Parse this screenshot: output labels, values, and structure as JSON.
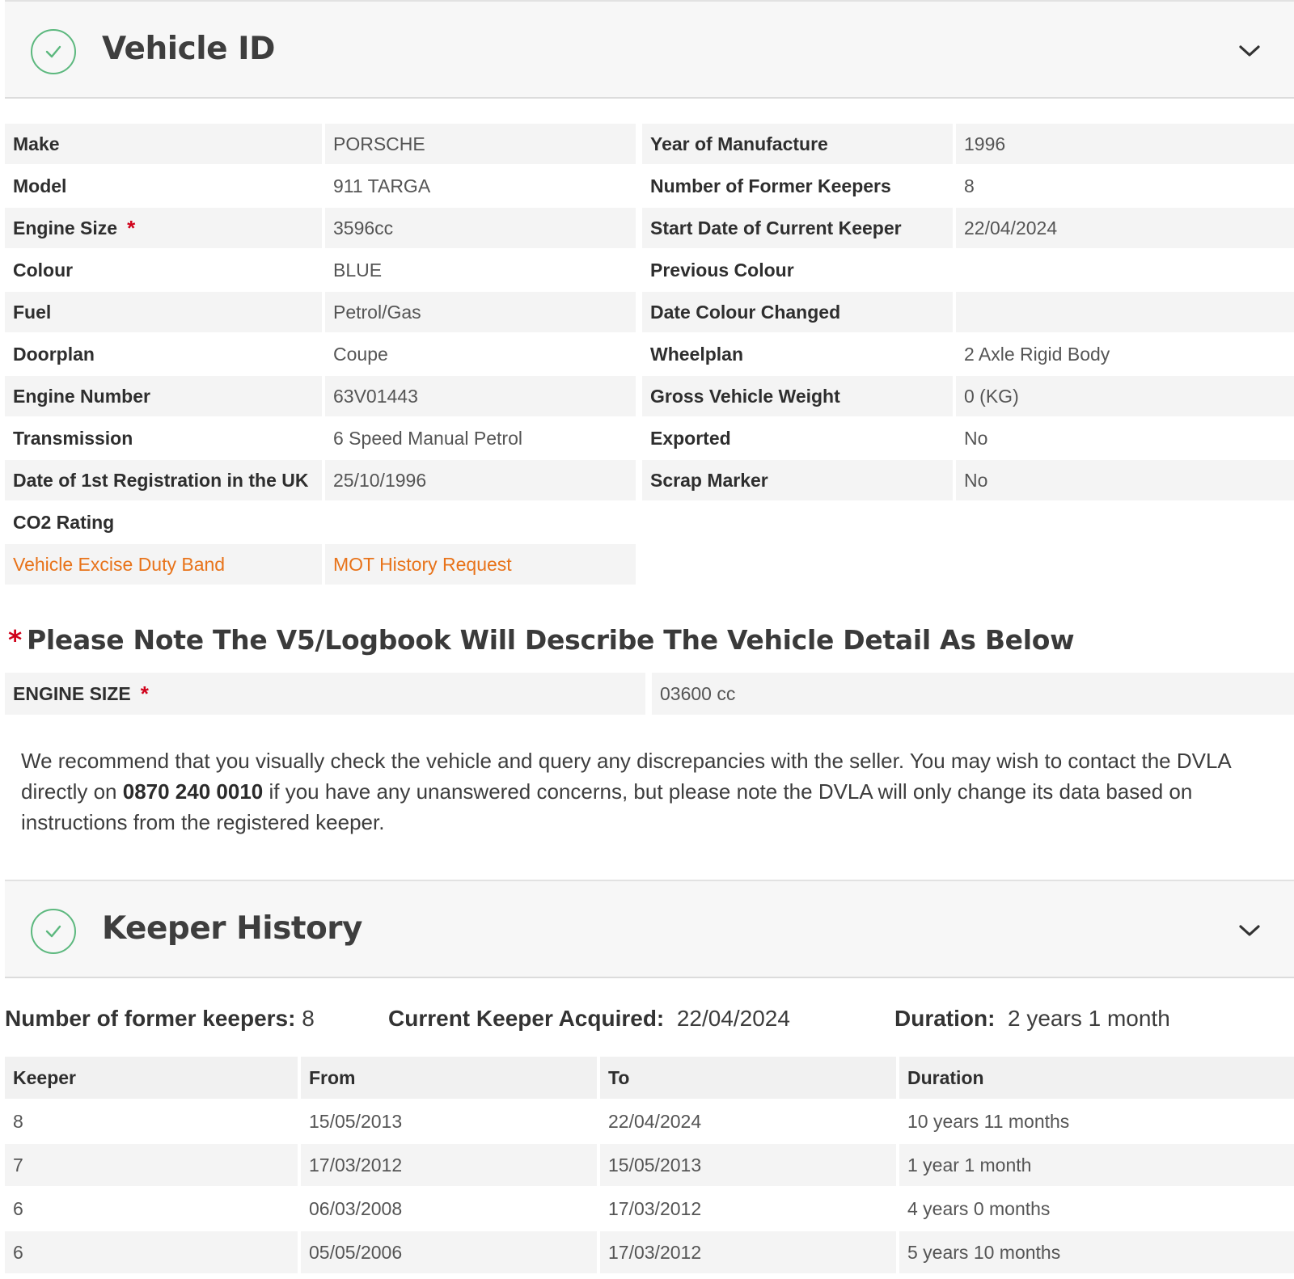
{
  "vehicle_id": {
    "title": "Vehicle ID",
    "rows": [
      {
        "l1": "Make",
        "v1": "PORSCHE",
        "l2": "Year of Manufacture",
        "v2": "1996"
      },
      {
        "l1": "Model",
        "v1": "911 TARGA",
        "l2": "Number of Former Keepers",
        "v2": "8"
      },
      {
        "l1": "Engine Size",
        "v1": "3596cc",
        "l2": "Start Date of Current Keeper",
        "v2": "22/04/2024"
      },
      {
        "l1": "Colour",
        "v1": "BLUE",
        "l2": "Previous Colour",
        "v2": ""
      },
      {
        "l1": "Fuel",
        "v1": "Petrol/Gas",
        "l2": "Date Colour Changed",
        "v2": ""
      },
      {
        "l1": "Doorplan",
        "v1": "Coupe",
        "l2": "Wheelplan",
        "v2": "2 Axle Rigid Body"
      },
      {
        "l1": "Engine Number",
        "v1": "63V01443",
        "l2": "Gross Vehicle Weight",
        "v2": "0 (KG)"
      },
      {
        "l1": "Transmission",
        "v1": "6 Speed Manual Petrol",
        "l2": "Exported",
        "v2": "No"
      },
      {
        "l1": "Date of 1st Registration in the UK",
        "v1": "25/10/1996",
        "l2": "Scrap Marker",
        "v2": "No"
      },
      {
        "l1": "CO2 Rating",
        "v1": ""
      },
      {
        "l1": "Vehicle Excise Duty Band",
        "v1": "MOT History Request"
      }
    ],
    "required_mark": "*"
  },
  "v5_note": {
    "star": "*",
    "title": "Please Note The V5/Logbook Will Describe The Vehicle Detail As Below",
    "label": "ENGINE SIZE",
    "value": "03600 cc"
  },
  "advice": {
    "text_before": "We recommend that you visually check the vehicle and query any discrepancies with the seller. You may wish to contact the DVLA directly on ",
    "phone": "0870 240 0010",
    "text_after": " if you have any unanswered concerns, but please note the DVLA will only change its data based on instructions from the registered keeper."
  },
  "keeper_history": {
    "title": "Keeper History",
    "summary": {
      "former_label": "Number of former keepers:",
      "former_value": "8",
      "acquired_label": "Current Keeper Acquired:",
      "acquired_value": "22/04/2024",
      "duration_label": "Duration:",
      "duration_value": "2 years 1 month"
    },
    "headers": [
      "Keeper",
      "From",
      "To",
      "Duration"
    ],
    "rows": [
      [
        "8",
        "15/05/2013",
        "22/04/2024",
        "10 years 11 months"
      ],
      [
        "7",
        "17/03/2012",
        "15/05/2013",
        "1 year 1 month"
      ],
      [
        "6",
        "06/03/2008",
        "17/03/2012",
        "4 years 0 months"
      ],
      [
        "6",
        "05/05/2006",
        "17/03/2012",
        "5 years 10 months"
      ]
    ]
  },
  "colors": {
    "accent_green": "#5cb87e",
    "link_orange": "#e8731a",
    "required_red": "#d0021b"
  },
  "icons": [
    "check-circle-icon",
    "chevron-down-icon"
  ]
}
